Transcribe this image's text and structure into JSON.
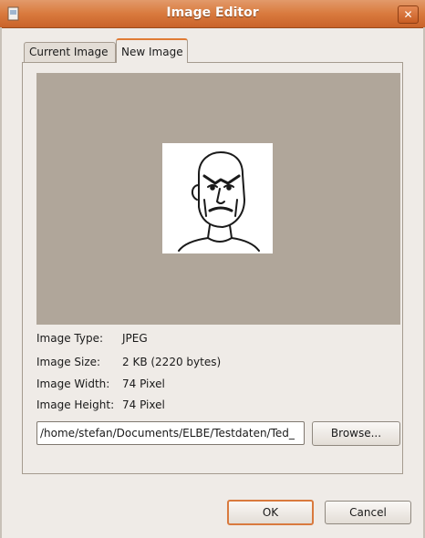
{
  "window": {
    "title": "Image Editor"
  },
  "tabs": [
    {
      "label": "Current Image"
    },
    {
      "label": "New Image"
    }
  ],
  "info": [
    {
      "label": "Image Type:",
      "value": "JPEG"
    },
    {
      "label": "Image Size:",
      "value": "2 KB (2220 bytes)"
    },
    {
      "label": "Image Width:",
      "value": "74 Pixel"
    },
    {
      "label": "Image Height:",
      "value": "74 Pixel"
    }
  ],
  "path": {
    "value": "/home/stefan/Documents/ELBE/Testdaten/Ted_"
  },
  "buttons": {
    "browse": "Browse...",
    "ok": "OK",
    "cancel": "Cancel"
  },
  "colors": {
    "titlebar": "#d97a3e",
    "preview_bg": "#b0a69a",
    "focus": "#d97a3e"
  }
}
